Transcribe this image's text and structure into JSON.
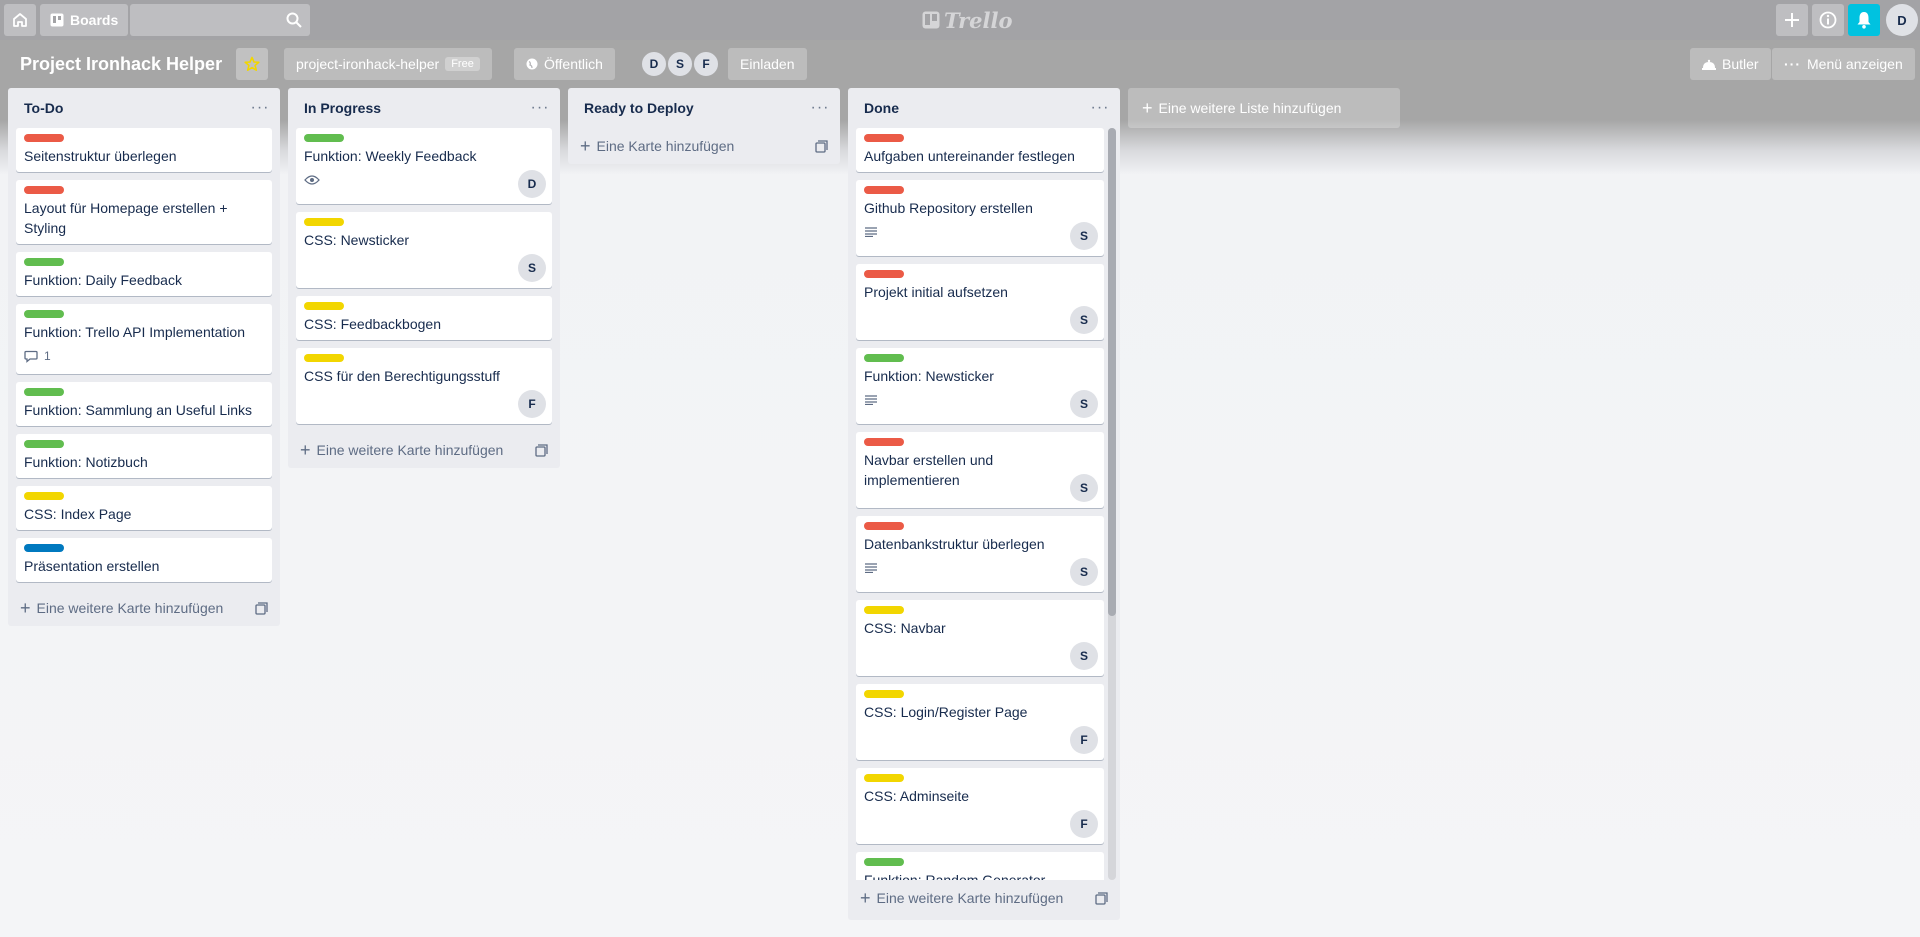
{
  "header": {
    "boards_label": "Boards",
    "search_value": "",
    "logo_text": "Trello",
    "user_initial": "D"
  },
  "board": {
    "title": "Project Ironhack Helper",
    "team_name": "project-ironhack-helper",
    "team_badge": "Free",
    "visibility": "Öffentlich",
    "members": [
      "D",
      "S",
      "F"
    ],
    "invite_label": "Einladen",
    "butler_label": "Butler",
    "menu_label": "Menü anzeigen"
  },
  "colors": {
    "green": "#61bd4f",
    "yellow": "#f2d600",
    "red": "#eb5a46",
    "blue": "#0079bf",
    "notification": "#00c2e0"
  },
  "lists": [
    {
      "title": "To-Do",
      "add_label": "Eine weitere Karte hinzufügen",
      "cards": [
        {
          "label": "red",
          "title": "Seitenstruktur überlegen"
        },
        {
          "label": "red",
          "title": "Layout für Homepage erstellen + Styling"
        },
        {
          "label": "green",
          "title": "Funktion: Daily Feedback"
        },
        {
          "label": "green",
          "title": "Funktion: Trello API Implementation",
          "comments": "1"
        },
        {
          "label": "green",
          "title": "Funktion: Sammlung an Useful Links"
        },
        {
          "label": "green",
          "title": "Funktion: Notizbuch"
        },
        {
          "label": "yellow",
          "title": "CSS: Index Page"
        },
        {
          "label": "blue",
          "title": "Präsentation erstellen"
        }
      ]
    },
    {
      "title": "In Progress",
      "add_label": "Eine weitere Karte hinzufügen",
      "cards": [
        {
          "label": "green",
          "title": "Funktion: Weekly Feedback",
          "watch": true,
          "member": "D"
        },
        {
          "label": "yellow",
          "title": "CSS: Newsticker",
          "member": "S"
        },
        {
          "label": "yellow",
          "title": "CSS: Feedbackbogen"
        },
        {
          "label": "yellow",
          "title": "CSS für den Berechtigungsstuff",
          "member": "F"
        }
      ]
    },
    {
      "title": "Ready to Deploy",
      "add_label": "Eine Karte hinzufügen",
      "cards": []
    },
    {
      "title": "Done",
      "add_label": "Eine weitere Karte hinzufügen",
      "cards": [
        {
          "label": "red",
          "title": "Aufgaben untereinander festlegen"
        },
        {
          "label": "red",
          "title": "Github Repository erstellen",
          "desc": true,
          "member": "S"
        },
        {
          "label": "red",
          "title": "Projekt initial aufsetzen",
          "member": "S"
        },
        {
          "label": "green",
          "title": "Funktion: Newsticker",
          "desc": true,
          "member": "S"
        },
        {
          "label": "red",
          "title": "Navbar erstellen und implementieren",
          "member": "S"
        },
        {
          "label": "red",
          "title": "Datenbankstruktur überlegen",
          "desc": true,
          "member": "S"
        },
        {
          "label": "yellow",
          "title": "CSS: Navbar",
          "member": "S"
        },
        {
          "label": "yellow",
          "title": "CSS: Login/Register Page",
          "member": "F"
        },
        {
          "label": "yellow",
          "title": "CSS: Adminseite",
          "member": "F"
        },
        {
          "label": "green",
          "title": "Funktion: Random Generator"
        }
      ]
    }
  ],
  "add_list_label": "Eine weitere Liste hinzufügen"
}
